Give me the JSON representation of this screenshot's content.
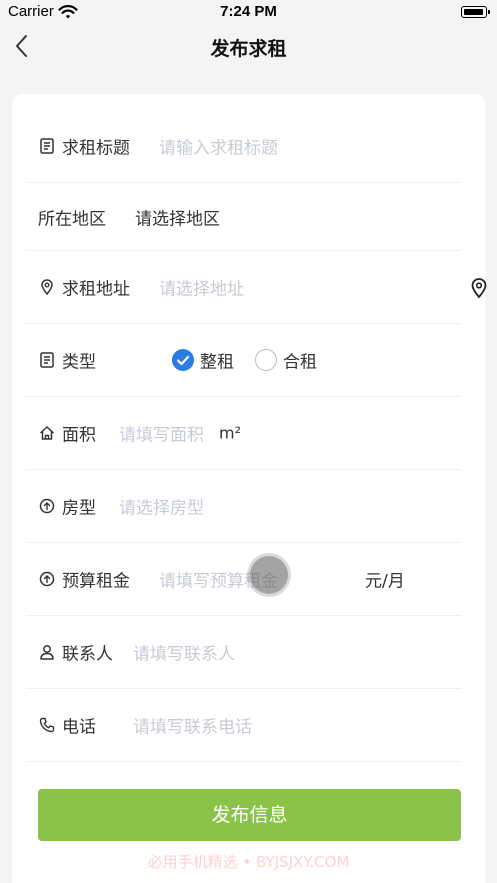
{
  "status_bar": {
    "carrier": "Carrier",
    "time": "7:24 PM",
    "icons": [
      "wifi-icon",
      "battery-icon"
    ]
  },
  "nav": {
    "back_icon": "chevron-left-icon",
    "title": "发布求租"
  },
  "form": {
    "title_field": {
      "icon": "document-icon",
      "label": "求租标题",
      "placeholder": "请输入求租标题"
    },
    "region_field": {
      "label": "所在地区",
      "value": "请选择地区"
    },
    "address_field": {
      "icon": "location-pin-icon",
      "label": "求租地址",
      "placeholder": "请选择地址",
      "side_icon": "location-pin-icon"
    },
    "type_field": {
      "icon": "document-icon",
      "label": "类型",
      "options": [
        {
          "label": "整租",
          "checked": true
        },
        {
          "label": "合租",
          "checked": false
        }
      ]
    },
    "area_field": {
      "icon": "home-icon",
      "label": "面积",
      "placeholder": "请填写面积",
      "unit": "m²"
    },
    "layout_field": {
      "icon": "circle-arrow-icon",
      "label": "房型",
      "placeholder": "请选择房型"
    },
    "budget_field": {
      "icon": "circle-arrow-icon",
      "label": "预算租金",
      "placeholder": "请填写预算租金",
      "unit": "元/月"
    },
    "contact_field": {
      "icon": "person-icon",
      "label": "联系人",
      "placeholder": "请填写联系人"
    },
    "phone_field": {
      "icon": "phone-icon",
      "label": "电话",
      "placeholder": "请填写联系电话"
    }
  },
  "submit_label": "发布信息",
  "watermark": "必用手机精选 • BYJSJXY.COM",
  "colors": {
    "accent_blue": "#2c7be5",
    "submit_green": "#8bc34a",
    "placeholder": "#c7cbd6",
    "background": "#f4f4f4"
  }
}
